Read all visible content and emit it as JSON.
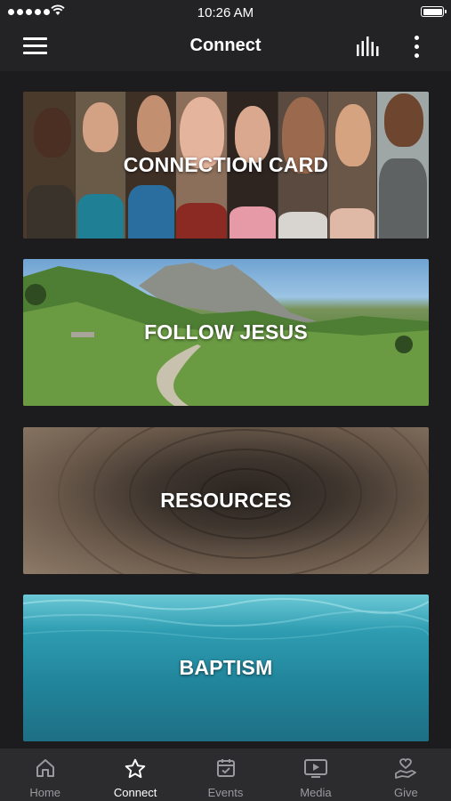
{
  "status_bar": {
    "time": "10:26 AM"
  },
  "header": {
    "title": "Connect"
  },
  "cards": [
    {
      "label": "CONNECTION CARD"
    },
    {
      "label": "FOLLOW JESUS"
    },
    {
      "label": "RESOURCES"
    },
    {
      "label": "BAPTISM"
    }
  ],
  "tabs": [
    {
      "label": "Home",
      "icon": "home-icon"
    },
    {
      "label": "Connect",
      "icon": "star-icon",
      "active": true
    },
    {
      "label": "Events",
      "icon": "calendar-icon"
    },
    {
      "label": "Media",
      "icon": "play-icon"
    },
    {
      "label": "Give",
      "icon": "heart-hand-icon"
    }
  ],
  "colors": {
    "background": "#1c1c1e",
    "bar": "#232325",
    "tab_bar": "#2c2c2e",
    "inactive": "#9a9a9e"
  }
}
